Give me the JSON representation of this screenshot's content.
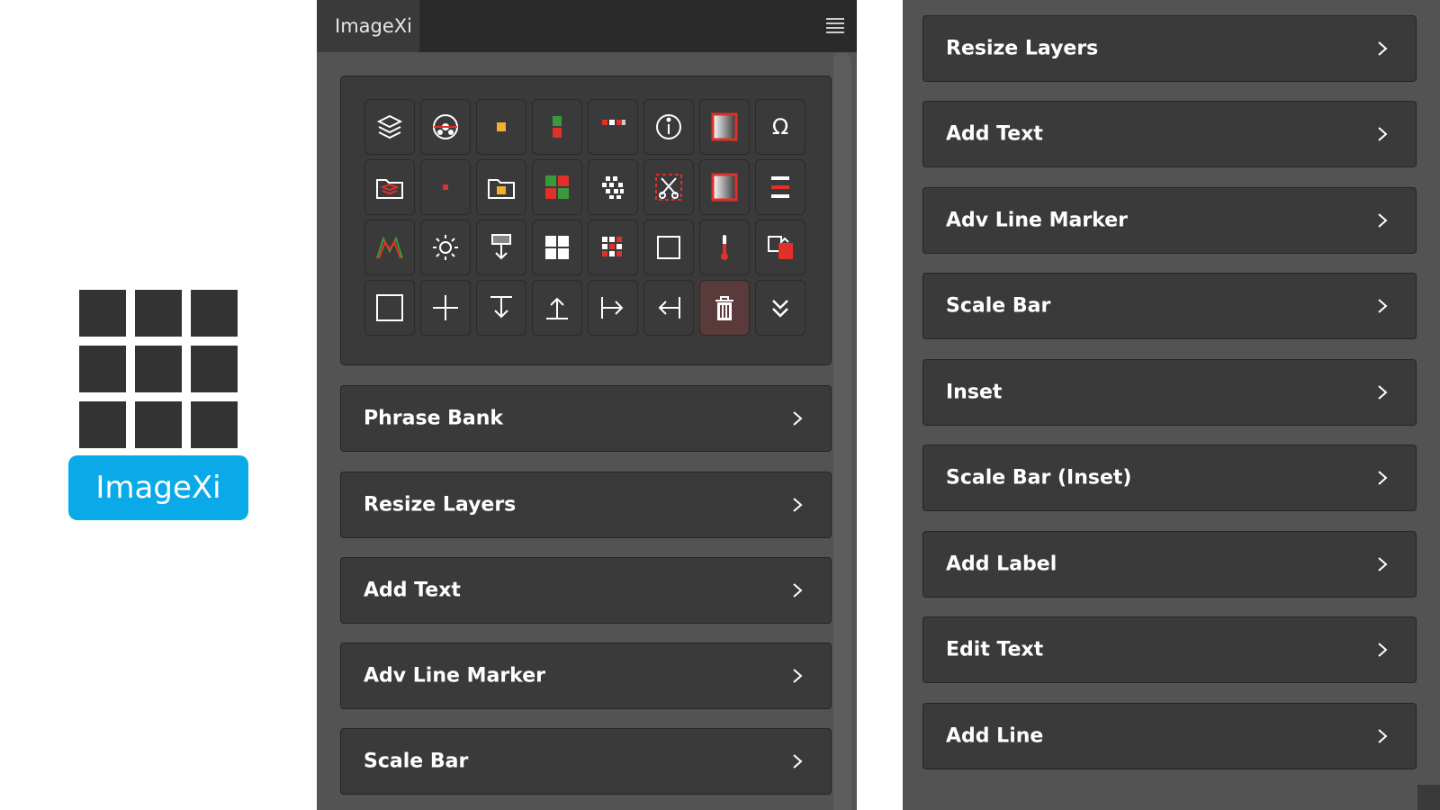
{
  "logo": {
    "badge_text": "ImageXi",
    "badge_color": "#0aa9e8",
    "grid_color": "#333333"
  },
  "panel": {
    "tab_title": "ImageXi",
    "menu_icon": "hamburger-icon",
    "tools": [
      "layers-icon",
      "target-circle-icon",
      "orange-square-icon",
      "green-red-blocks-icon",
      "red-white-dots-icon",
      "info-icon",
      "gradient-frame-icon",
      "omega-icon",
      "folder-layers-icon",
      "red-dot-icon",
      "folder-square-icon",
      "color-grid-icon",
      "pixel-cluster-icon",
      "scissors-crop-icon",
      "gradient-frame-icon",
      "align-center-icon",
      "mountain-chart-icon",
      "sun-icon",
      "stamp-down-icon",
      "four-squares-icon",
      "dot-grid-icon",
      "square-outline-icon",
      "thermometer-icon",
      "copy-red-icon",
      "square-outline-icon",
      "plus-icon",
      "align-top-icon",
      "align-bottom-icon",
      "align-left-icon",
      "align-right-icon",
      "trash-icon",
      "double-chevron-down-icon"
    ],
    "rows": [
      "Phrase Bank",
      "Resize Layers",
      "Add Text",
      "Adv Line Marker",
      "Scale Bar"
    ]
  },
  "panel2": {
    "rows": [
      "Resize Layers",
      "Add Text",
      "Adv Line Marker",
      "Scale Bar",
      "Inset",
      "Scale Bar (Inset)",
      "Add Label",
      "Edit Text",
      "Add Line"
    ]
  },
  "colors": {
    "panel_bg": "#535353",
    "button_bg": "#3a3a3a",
    "accent_red": "#e0302a",
    "accent_green": "#3a9a3a",
    "accent_orange": "#f0b030"
  }
}
